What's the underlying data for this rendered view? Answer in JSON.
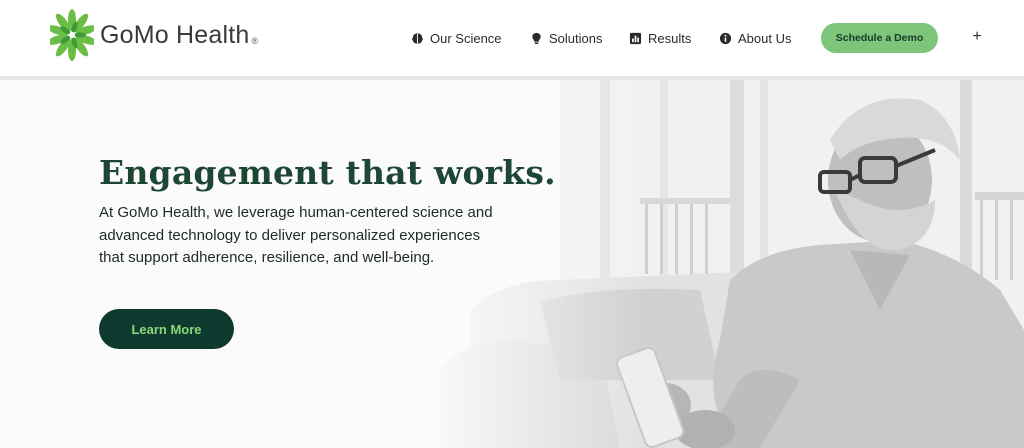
{
  "brand": {
    "name": "GoMo Health",
    "registered_mark": "®",
    "accent_color": "#6cbd45"
  },
  "nav": {
    "items": [
      {
        "label": "Our Science",
        "icon": "brain-icon"
      },
      {
        "label": "Solutions",
        "icon": "lightbulb-icon"
      },
      {
        "label": "Results",
        "icon": "bar-chart-icon"
      },
      {
        "label": "About Us",
        "icon": "info-icon"
      }
    ],
    "cta_label": "Schedule a Demo",
    "cta_color": "#7dc57a",
    "expand_label": "+"
  },
  "hero": {
    "title": "Engagement that works.",
    "body": "At GoMo Health, we leverage human-centered science and advanced technology to deliver personalized experiences that support adherence, resilience, and well-being.",
    "button_label": "Learn More",
    "title_color": "#1d4634",
    "button_color": "#0e3a2f"
  }
}
